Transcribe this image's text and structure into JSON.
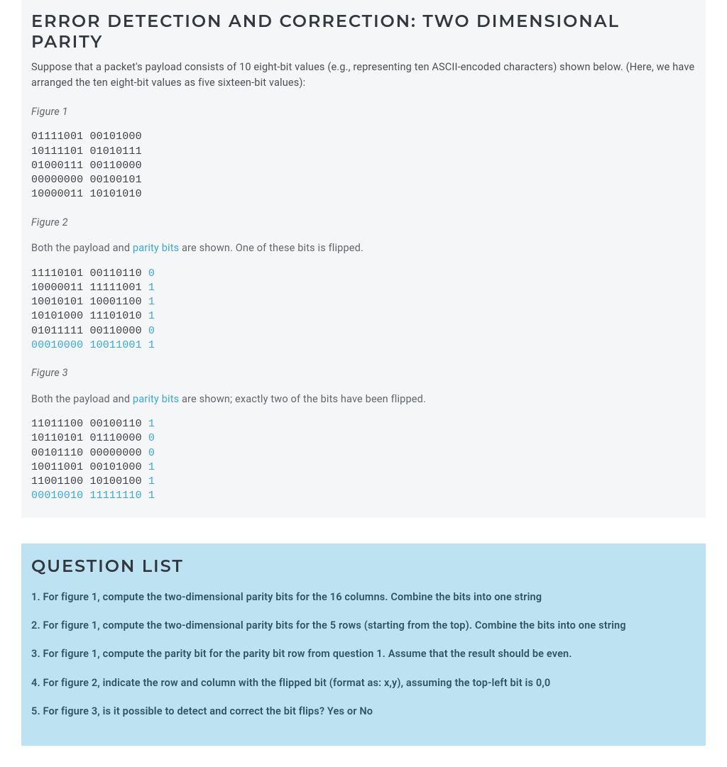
{
  "title": "ERROR DETECTION AND CORRECTION: TWO DIMENSIONAL PARITY",
  "description": "Suppose that a packet's payload consists of 10 eight-bit values (e.g., representing ten ASCII-encoded characters) shown below. (Here, we have arranged the ten eight-bit values as five sixteen-bit values):",
  "figures": {
    "fig1": {
      "caption": "Figure 1",
      "rows": [
        {
          "payload": "01111001 00101000"
        },
        {
          "payload": "10111101 01010111"
        },
        {
          "payload": "01000111 00110000"
        },
        {
          "payload": "00000000 00100101"
        },
        {
          "payload": "10000011 10101010"
        }
      ]
    },
    "fig2": {
      "caption": "Figure 2",
      "intro_pre": "Both the payload and ",
      "intro_link": "parity bits",
      "intro_post": " are shown. One of these bits is flipped.",
      "rows": [
        {
          "payload": "11110101 00110110",
          "parity": "0",
          "row_is_parity": false
        },
        {
          "payload": "10000011 11111001",
          "parity": "1",
          "row_is_parity": false
        },
        {
          "payload": "10010101 10001100",
          "parity": "1",
          "row_is_parity": false
        },
        {
          "payload": "10101000 11101010",
          "parity": "1",
          "row_is_parity": false
        },
        {
          "payload": "01011111 00110000",
          "parity": "0",
          "row_is_parity": false
        },
        {
          "payload": "00010000 10011001",
          "parity": "1",
          "row_is_parity": true
        }
      ]
    },
    "fig3": {
      "caption": "Figure 3",
      "intro_pre": "Both the payload and ",
      "intro_link": "parity bits",
      "intro_post": " are shown; exactly two of the bits have been flipped.",
      "rows": [
        {
          "payload": "11011100 00100110",
          "parity": "1",
          "row_is_parity": false
        },
        {
          "payload": "10110101 01110000",
          "parity": "0",
          "row_is_parity": false
        },
        {
          "payload": "00101110 00000000",
          "parity": "0",
          "row_is_parity": false
        },
        {
          "payload": "10011001 00101000",
          "parity": "1",
          "row_is_parity": false
        },
        {
          "payload": "11001100 10100100",
          "parity": "1",
          "row_is_parity": false
        },
        {
          "payload": "00010010 11111110",
          "parity": "1",
          "row_is_parity": true
        }
      ]
    }
  },
  "question_list": {
    "title": "QUESTION LIST",
    "items": [
      "1. For figure 1, compute the two-dimensional parity bits for the 16 columns. Combine the bits into one string",
      "2. For figure 1, compute the two-dimensional parity bits for the 5 rows (starting from the top). Combine the bits into one string",
      "3. For figure 1, compute the parity bit for the parity bit row from question 1. Assume that the result should be even.",
      "4. For figure 2, indicate the row and column with the flipped bit (format as: x,y), assuming the top-left bit is 0,0",
      "5. For figure 3, is it possible to detect and correct the bit flips? Yes or No"
    ]
  }
}
